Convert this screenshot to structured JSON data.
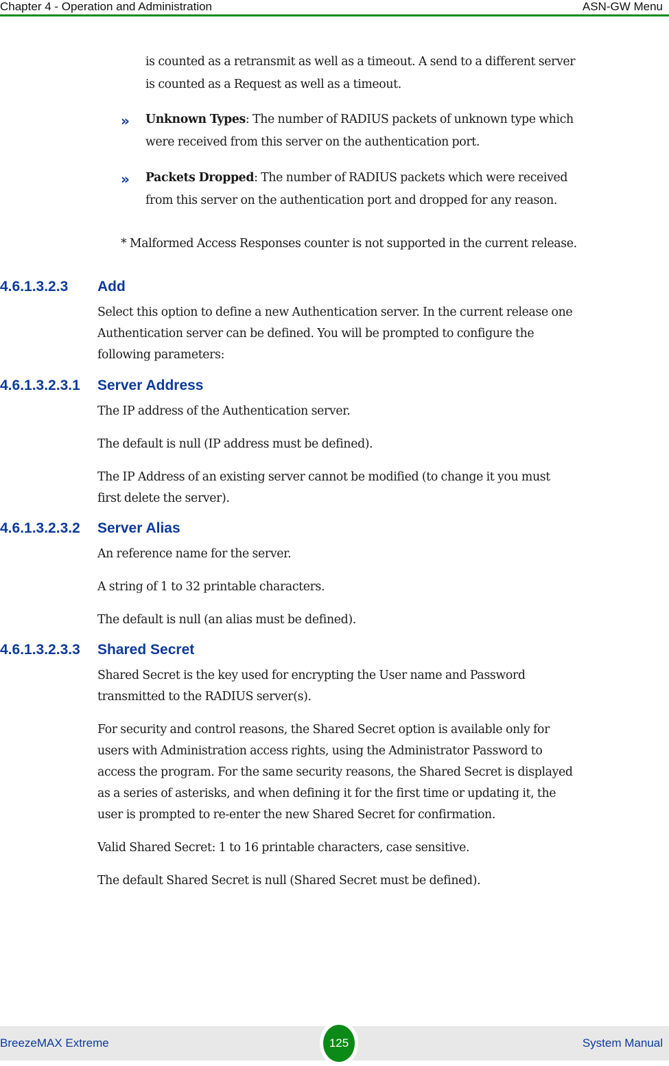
{
  "header": {
    "chapter": "Chapter 4 - Operation and Administration",
    "section": "ASN-GW Menu"
  },
  "intro": {
    "line1": "is counted as a retransmit as well as a timeout. A send to a different server",
    "line2": "is counted as a Request as well as a timeout."
  },
  "bullets": [
    {
      "term": "Unknown Types",
      "line1": ": The number of RADIUS packets of unknown type which",
      "line2": "were received from this server on the authentication port."
    },
    {
      "term": "Packets Dropped",
      "line1": ": The number of RADIUS packets which were received",
      "line2": "from this server on the authentication port and dropped for any reason."
    }
  ],
  "bullet_glyph": "»",
  "footnote": "* Malformed Access Responses counter is not supported in the current release.",
  "sections": {
    "add": {
      "number": "4.6.1.3.2.3",
      "title": "Add",
      "lines": [
        "Select this option to define a new Authentication server. In the current release one",
        "Authentication server can be defined. You will be prompted to configure the",
        "following parameters:"
      ]
    },
    "server_address": {
      "number": "4.6.1.3.2.3.1",
      "title": "Server Address",
      "p1": "The IP address of the Authentication server.",
      "p2": "The default is null (IP address must be defined).",
      "p3_line1": "The IP Address of an existing server cannot be modified (to change it you must",
      "p3_line2": "first delete the server)."
    },
    "server_alias": {
      "number": "4.6.1.3.2.3.2",
      "title": "Server Alias",
      "p1": "An reference name for the server.",
      "p2": "A string of 1 to 32 printable characters.",
      "p3": "The default is null (an alias must be defined)."
    },
    "shared_secret": {
      "number": "4.6.1.3.2.3.3",
      "title": "Shared Secret",
      "p1_lines": [
        "Shared Secret is the key used for encrypting the User name and Password",
        "transmitted to the RADIUS server(s)."
      ],
      "p2_lines": [
        "For security and control reasons, the Shared Secret option is available only for",
        "users with Administration access rights, using the Administrator Password to",
        "access the program. For the same security reasons, the Shared Secret is displayed",
        "as a series of asterisks, and when defining it for the first time or updating it, the",
        "user is prompted to re-enter the new Shared Secret for confirmation."
      ],
      "p3": "Valid Shared Secret: 1 to 16 printable characters, case sensitive.",
      "p4": "The default Shared Secret is null (Shared Secret must be defined)."
    }
  },
  "footer": {
    "product": "BreezeMAX Extreme",
    "page_number": "125",
    "doc_type": "System Manual"
  },
  "colors": {
    "accent_green": "#0b8a17",
    "heading_blue": "#0d3a9a",
    "footer_bg": "#e8e8e8"
  }
}
